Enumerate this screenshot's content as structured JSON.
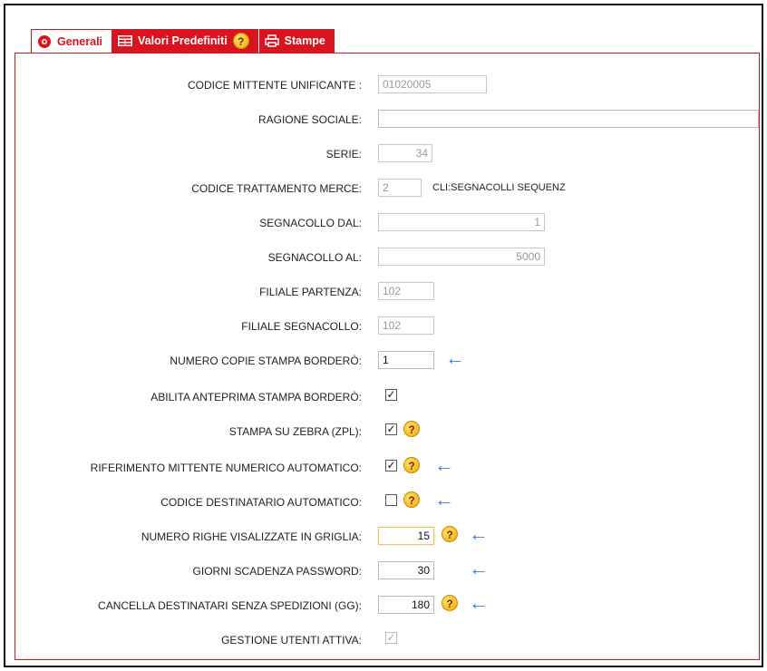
{
  "tabs": [
    {
      "label": "Generali",
      "icon": "gear-icon",
      "active": true
    },
    {
      "label": "Valori Predefiniti",
      "icon": "table-icon",
      "active": false
    },
    {
      "label": "Stampe",
      "icon": "printer-icon",
      "active": false
    }
  ],
  "fields": {
    "codice_mittente": {
      "label": "CODICE MITTENTE UNIFICANTE :",
      "value": "01020005"
    },
    "ragione_sociale": {
      "label": "RAGIONE SOCIALE:",
      "value": ""
    },
    "serie": {
      "label": "SERIE:",
      "value": "34"
    },
    "codice_trattamento": {
      "label": "CODICE TRATTAMENTO MERCE:",
      "value": "2",
      "note": "CLI:SEGNACOLLI SEQUENZ"
    },
    "segnacollo_dal": {
      "label": "SEGNACOLLO DAL:",
      "value": "1"
    },
    "segnacollo_al": {
      "label": "SEGNACOLLO AL:",
      "value": "5000"
    },
    "filiale_partenza": {
      "label": "FILIALE PARTENZA:",
      "value": "102"
    },
    "filiale_segnacollo": {
      "label": "FILIALE SEGNACOLLO:",
      "value": "102"
    },
    "numero_copie": {
      "label": "NUMERO COPIE STAMPA BORDERÒ:",
      "value": "1"
    },
    "anteprima": {
      "label": "ABILITA ANTEPRIMA STAMPA BORDERÒ:",
      "checked": true
    },
    "zebra": {
      "label": "STAMPA SU ZEBRA (ZPL):",
      "checked": true
    },
    "riferimento": {
      "label": "RIFERIMENTO MITTENTE NUMERICO AUTOMATICO:",
      "checked": true
    },
    "codice_destinatario": {
      "label": "CODICE DESTINATARIO AUTOMATICO:",
      "checked": false
    },
    "numero_righe": {
      "label": "NUMERO RIGHE VISALIZZATE IN GRIGLIA:",
      "value": "15"
    },
    "giorni_scadenza": {
      "label": "GIORNI SCADENZA PASSWORD:",
      "value": "30"
    },
    "cancella_destinatari": {
      "label": "CANCELLA DESTINATARI SENZA SPEDIZIONI (GG):",
      "value": "180"
    },
    "gestione_utenti": {
      "label": "GESTIONE UTENTI ATTIVA:",
      "checked": true
    }
  },
  "glyphs": {
    "help": "?",
    "check": "✓",
    "arrow": "←"
  },
  "colors": {
    "accent": "#d9141e",
    "arrow": "#3b7fd6",
    "help": "#f0a800"
  }
}
